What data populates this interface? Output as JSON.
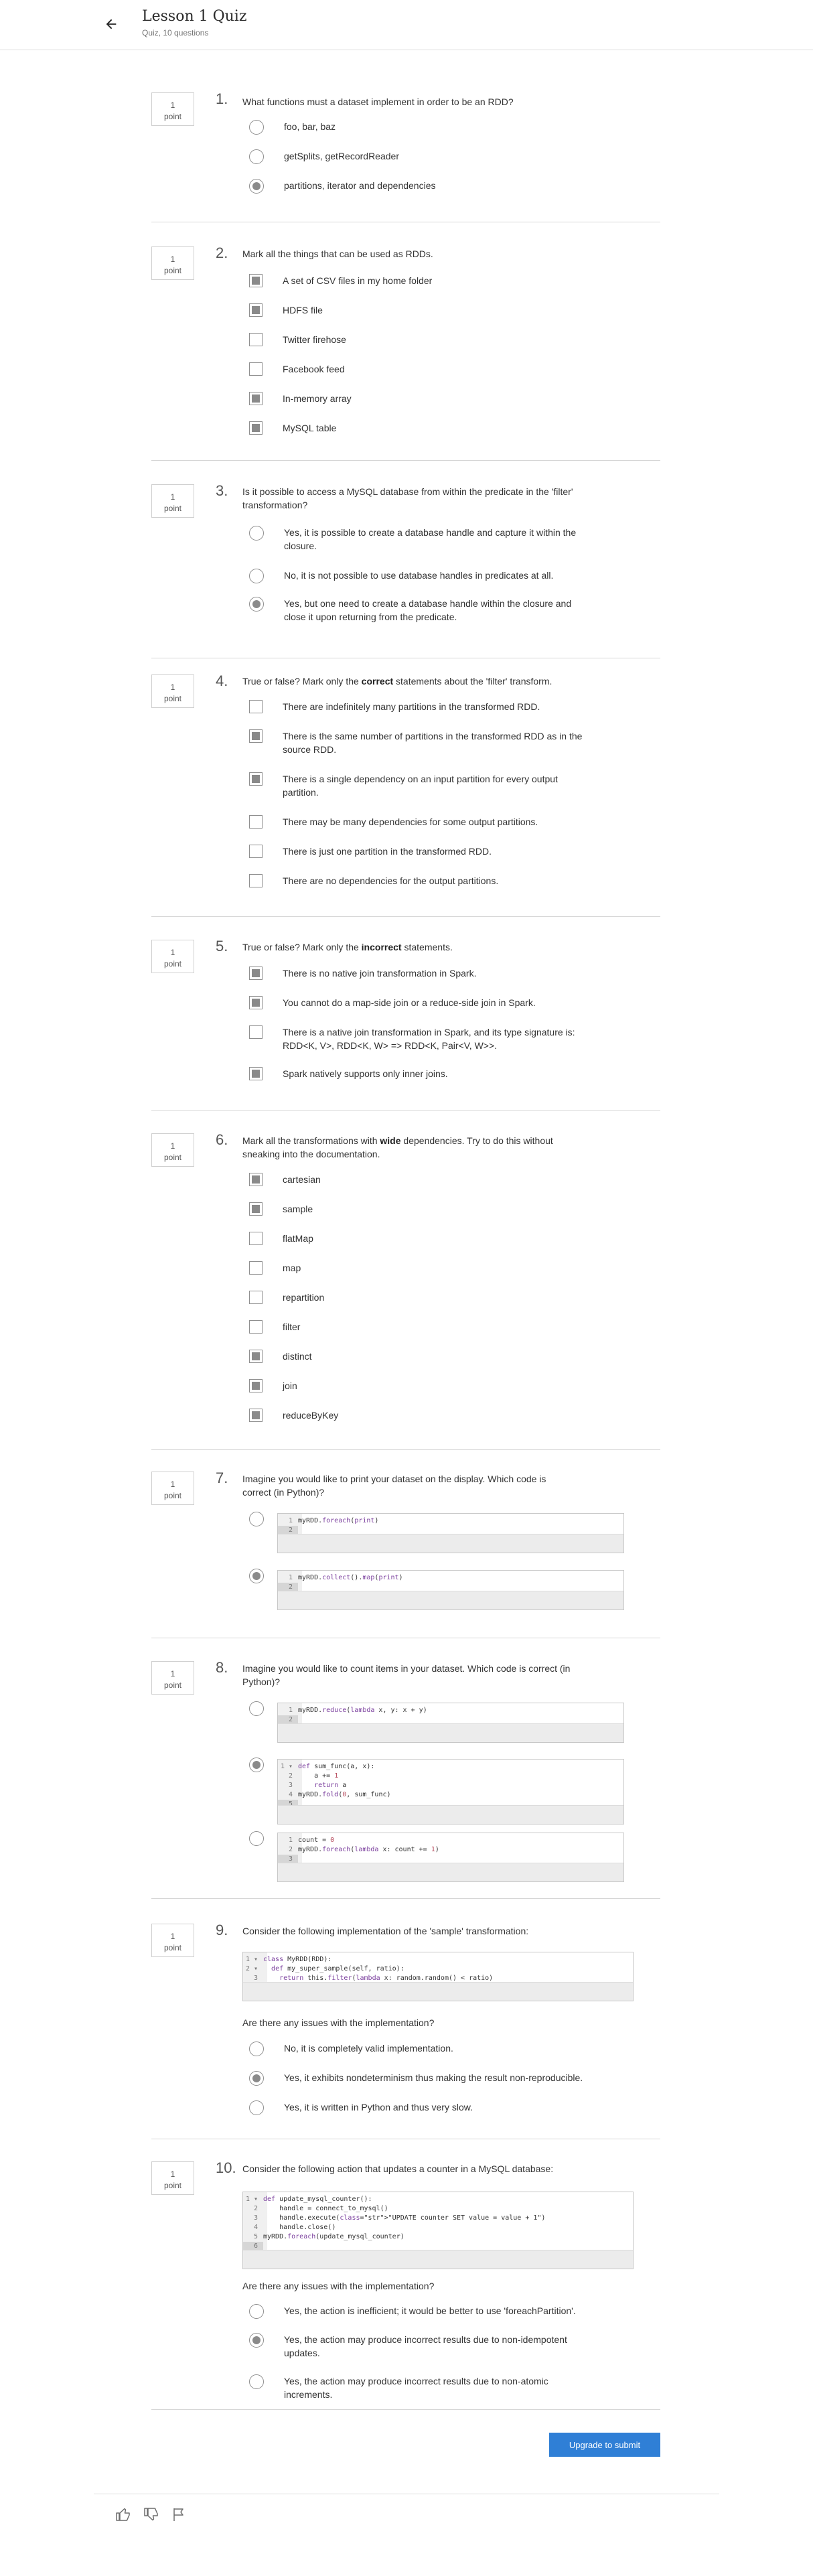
{
  "header": {
    "title": "Lesson 1 Quiz",
    "subtitle": "Quiz, 10 questions"
  },
  "questions": [
    {
      "number": "1.",
      "points": "1",
      "points_unit": "point",
      "text": "What functions must a dataset implement in order to be an RDD?",
      "type": "radio",
      "options": [
        {
          "label": "foo, bar, baz",
          "selected": false
        },
        {
          "label": "getSplits, getRecordReader",
          "selected": false
        },
        {
          "label": "partitions, iterator and dependencies",
          "selected": true
        }
      ]
    },
    {
      "number": "2.",
      "points": "1",
      "points_unit": "point",
      "text": "Mark all the things that can be used as RDDs.",
      "type": "checkbox",
      "options": [
        {
          "label": "A set of CSV files in my home folder",
          "selected": true
        },
        {
          "label": "HDFS file",
          "selected": true
        },
        {
          "label": "Twitter firehose",
          "selected": false
        },
        {
          "label": "Facebook feed",
          "selected": false
        },
        {
          "label": "In-memory array",
          "selected": true
        },
        {
          "label": "MySQL table",
          "selected": true
        }
      ]
    },
    {
      "number": "3.",
      "points": "1",
      "points_unit": "point",
      "text": "Is it possible to access a MySQL database from within the predicate in the 'filter' transformation?",
      "type": "radio",
      "options": [
        {
          "label": "Yes, it is possible to create a database handle and capture it within the closure.",
          "selected": false
        },
        {
          "label": "No, it is not possible to use database handles in predicates at all.",
          "selected": false
        },
        {
          "label": "Yes, but one need to create a database handle within the closure and close it upon returning from the predicate.",
          "selected": true
        }
      ]
    },
    {
      "number": "4.",
      "points": "1",
      "points_unit": "point",
      "text_before": "True or false? Mark only the ",
      "text_bold": "correct",
      "text_after": " statements about the 'filter' transform.",
      "type": "checkbox",
      "options": [
        {
          "label": "There are indefinitely many partitions in the transformed RDD.",
          "selected": false
        },
        {
          "label": "There is the same number of partitions in the transformed RDD as in the source RDD.",
          "selected": true
        },
        {
          "label": "There is a single dependency on an input partition for every output partition.",
          "selected": true
        },
        {
          "label": "There may be many dependencies for some output partitions.",
          "selected": false
        },
        {
          "label": "There is just one partition in the transformed RDD.",
          "selected": false
        },
        {
          "label": "There are no dependencies for the output partitions.",
          "selected": false
        }
      ]
    },
    {
      "number": "5.",
      "points": "1",
      "points_unit": "point",
      "text_before": "True or false? Mark only the ",
      "text_bold": "incorrect",
      "text_after": " statements.",
      "type": "checkbox",
      "options": [
        {
          "label": "There is no native join transformation in Spark.",
          "selected": true
        },
        {
          "label": "You cannot do a map-side join or a reduce-side join in Spark.",
          "selected": true
        },
        {
          "label": "There is a native join transformation in Spark, and its type signature is: RDD<K, V>, RDD<K, W> => RDD<K, Pair<V, W>>.",
          "selected": false
        },
        {
          "label": "Spark natively supports only inner joins.",
          "selected": true
        }
      ]
    },
    {
      "number": "6.",
      "points": "1",
      "points_unit": "point",
      "text_before": "Mark all the transformations with ",
      "text_bold": "wide",
      "text_after": " dependencies. Try to do this without sneaking into the documentation.",
      "type": "checkbox",
      "options": [
        {
          "label": "cartesian",
          "selected": true
        },
        {
          "label": "sample",
          "selected": true
        },
        {
          "label": "flatMap",
          "selected": false
        },
        {
          "label": "map",
          "selected": false
        },
        {
          "label": "repartition",
          "selected": false
        },
        {
          "label": "filter",
          "selected": false
        },
        {
          "label": "distinct",
          "selected": true
        },
        {
          "label": "join",
          "selected": true
        },
        {
          "label": "reduceByKey",
          "selected": true
        }
      ]
    },
    {
      "number": "7.",
      "points": "1",
      "points_unit": "point",
      "text": "Imagine you would like to print your dataset on the display. Which code is correct (in Python)?",
      "type": "radio",
      "options": [
        {
          "selected": false,
          "code": [
            {
              "n": "1",
              "t": "myRDD.foreach(print)"
            },
            {
              "n": "2",
              "t": ""
            }
          ]
        },
        {
          "selected": true,
          "code": [
            {
              "n": "1",
              "t": "myRDD.collect().map(print)"
            },
            {
              "n": "2",
              "t": ""
            }
          ]
        }
      ]
    },
    {
      "number": "8.",
      "points": "1",
      "points_unit": "point",
      "text": "Imagine you would like to count items in your dataset. Which code is correct (in Python)?",
      "type": "radio",
      "options": [
        {
          "selected": false,
          "code": [
            {
              "n": "1",
              "t": "myRDD.reduce(lambda x, y: x + y)"
            },
            {
              "n": "2",
              "t": ""
            }
          ]
        },
        {
          "selected": true,
          "code": [
            {
              "n": "1 ▾",
              "t": "def sum_func(a, x):"
            },
            {
              "n": "2",
              "t": "    a += 1"
            },
            {
              "n": "3",
              "t": "    return a"
            },
            {
              "n": "4",
              "t": "myRDD.fold(0, sum_func)"
            },
            {
              "n": "5",
              "t": ""
            }
          ]
        },
        {
          "selected": false,
          "code": [
            {
              "n": "1",
              "t": "count = 0"
            },
            {
              "n": "2",
              "t": "myRDD.foreach(lambda x: count += 1)"
            },
            {
              "n": "3",
              "t": ""
            }
          ]
        }
      ]
    },
    {
      "number": "9.",
      "points": "1",
      "points_unit": "point",
      "text": "Consider the following implementation of the 'sample' transformation:",
      "code": [
        {
          "n": "1 ▾",
          "t": "class MyRDD(RDD):"
        },
        {
          "n": "2 ▾",
          "t": "  def my_super_sample(self, ratio):"
        },
        {
          "n": "3",
          "t": "    return this.filter(lambda x: random.random() < ratio)"
        },
        {
          "n": "4",
          "t": ""
        }
      ],
      "subtext": "Are there any issues with the implementation?",
      "type": "radio",
      "options": [
        {
          "label": "No, it is completely valid implementation.",
          "selected": false
        },
        {
          "label": "Yes, it exhibits nondeterminism thus making the result non-reproducible.",
          "selected": true
        },
        {
          "label": "Yes, it is written in Python and thus very slow.",
          "selected": false
        }
      ]
    },
    {
      "number": "10.",
      "points": "1",
      "points_unit": "point",
      "text": "Consider the following action that updates a counter in a MySQL database:",
      "code": [
        {
          "n": "1 ▾",
          "t": "def update_mysql_counter():"
        },
        {
          "n": "2",
          "t": "    handle = connect_to_mysql()"
        },
        {
          "n": "3",
          "t": "    handle.execute(\"UPDATE counter SET value = value + 1\")"
        },
        {
          "n": "4",
          "t": "    handle.close()"
        },
        {
          "n": "5",
          "t": "myRDD.foreach(update_mysql_counter)"
        },
        {
          "n": "6",
          "t": ""
        }
      ],
      "subtext": "Are there any issues with the implementation?",
      "type": "radio",
      "options": [
        {
          "label": "Yes, the action is inefficient; it would be better to use 'foreachPartition'.",
          "selected": false
        },
        {
          "label": "Yes, the action may produce incorrect results due to non-idempotent updates.",
          "selected": true
        },
        {
          "label": "Yes, the action may produce incorrect results due to non-atomic increments.",
          "selected": false
        }
      ]
    }
  ],
  "submit_label": "Upgrade to submit",
  "footer_icons": [
    "thumbs-up-icon",
    "thumbs-down-icon",
    "flag-icon"
  ],
  "colors": {
    "primary_button": "#2f7fd6",
    "selected_control": "#8a8a8a",
    "divider": "#d6d6d6"
  }
}
